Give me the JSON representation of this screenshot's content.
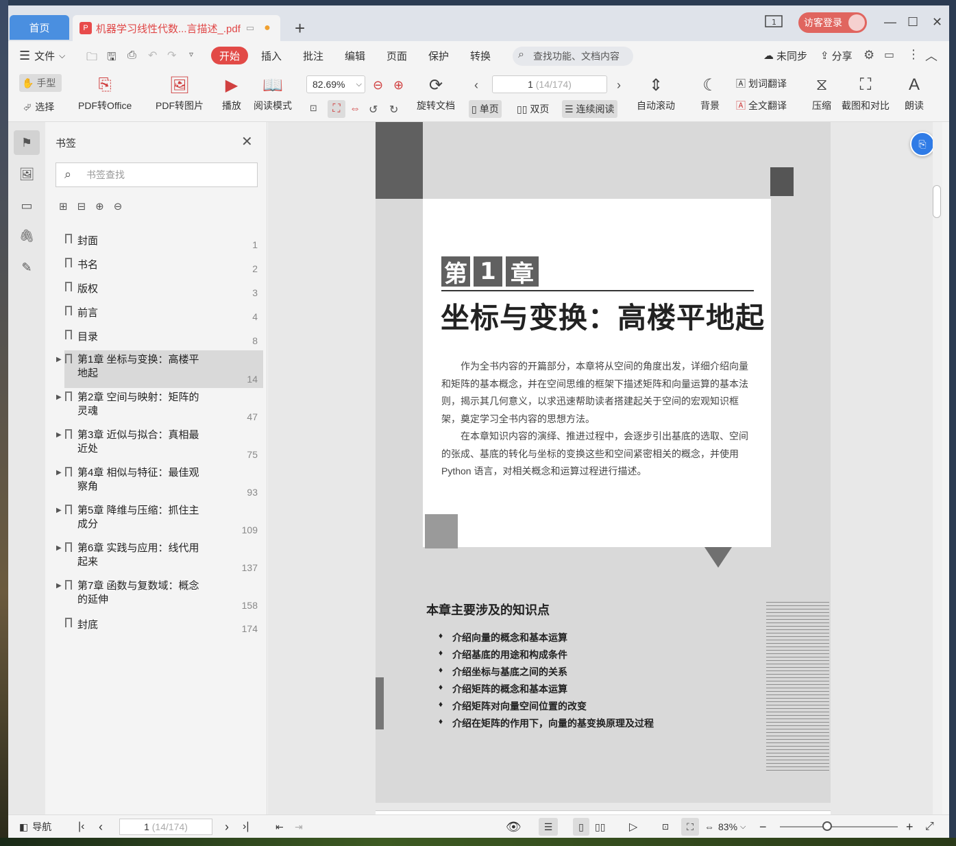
{
  "titlebar": {
    "home_tab": "首页",
    "doc_tab": "机器学习线性代数...言描述_.pdf",
    "pdf_badge": "P",
    "login_label": "访客登录"
  },
  "menubar": {
    "file": "文件",
    "tabs": [
      "开始",
      "插入",
      "批注",
      "编辑",
      "页面",
      "保护",
      "转换"
    ],
    "search_placeholder": "查找功能、文档内容",
    "sync": "未同步",
    "share": "分享"
  },
  "toolbar": {
    "hand": "手型",
    "select": "选择",
    "pdf_to_office": "PDF转Office",
    "pdf_to_image": "PDF转图片",
    "play": "播放",
    "read_mode": "阅读模式",
    "zoom": "82.69%",
    "rotate": "旋转文档",
    "page_current": "1",
    "page_total": "(14/174)",
    "single": "单页",
    "double": "双页",
    "continuous": "连续阅读",
    "auto_scroll": "自动滚动",
    "background": "背景",
    "word_translate": "划词翻译",
    "full_translate": "全文翻译",
    "compress": "压缩",
    "screenshot_compare": "截图和对比",
    "read_aloud": "朗读"
  },
  "panel": {
    "title": "书签",
    "search_placeholder": "书签查找",
    "items": [
      {
        "label": "封面",
        "page": "1"
      },
      {
        "label": "书名",
        "page": "2"
      },
      {
        "label": "版权",
        "page": "3"
      },
      {
        "label": "前言",
        "page": "4"
      },
      {
        "label": "目录",
        "page": "8"
      },
      {
        "label1": "第1章 坐标与变换：高楼平",
        "label2": "地起",
        "page": "14"
      },
      {
        "label1": "第2章 空间与映射：矩阵的",
        "label2": "灵魂",
        "page": "47"
      },
      {
        "label1": "第3章 近似与拟合：真相最",
        "label2": "近处",
        "page": "75"
      },
      {
        "label1": "第4章 相似与特征：最佳观",
        "label2": "察角",
        "page": "93"
      },
      {
        "label1": "第5章 降维与压缩：抓住主",
        "label2": "成分",
        "page": "109"
      },
      {
        "label1": "第6章 实践与应用：线代用",
        "label2": "起来",
        "page": "137"
      },
      {
        "label1": "第7章 函数与复数域：概念",
        "label2": "的延伸",
        "page": "158"
      },
      {
        "label": "封底",
        "page": "174"
      }
    ]
  },
  "page": {
    "chap_1": "第",
    "chap_num": "1",
    "chap_2": "章",
    "title": "坐标与变换：高楼平地起",
    "intro_p1": "作为全书内容的开篇部分，本章将从空间的角度出发，详细介绍向量和矩阵的基本概念，并在空间思维的框架下描述矩阵和向量运算的基本法则，揭示其几何意义，以求迅速帮助读者搭建起关于空间的宏观知识框架，奠定学习全书内容的思想方法。",
    "intro_p2": "在本章知识内容的演绎、推进过程中，会逐步引出基底的选取、空间的张成、基底的转化与坐标的变换这些和空间紧密相关的概念，并使用 Python 语言，对相关概念和运算过程进行描述。",
    "topics_title": "本章主要涉及的知识点",
    "topics": [
      "介绍向量的概念和基本运算",
      "介绍基底的用途和构成条件",
      "介绍坐标与基底之间的关系",
      "介绍矩阵的概念和基本运算",
      "介绍矩阵对向量空间位置的改变",
      "介绍在矩阵的作用下，向量的基变换原理及过程"
    ]
  },
  "statusbar": {
    "nav": "导航",
    "page_current": "1",
    "page_total": "(14/174)",
    "zoom": "83%"
  }
}
